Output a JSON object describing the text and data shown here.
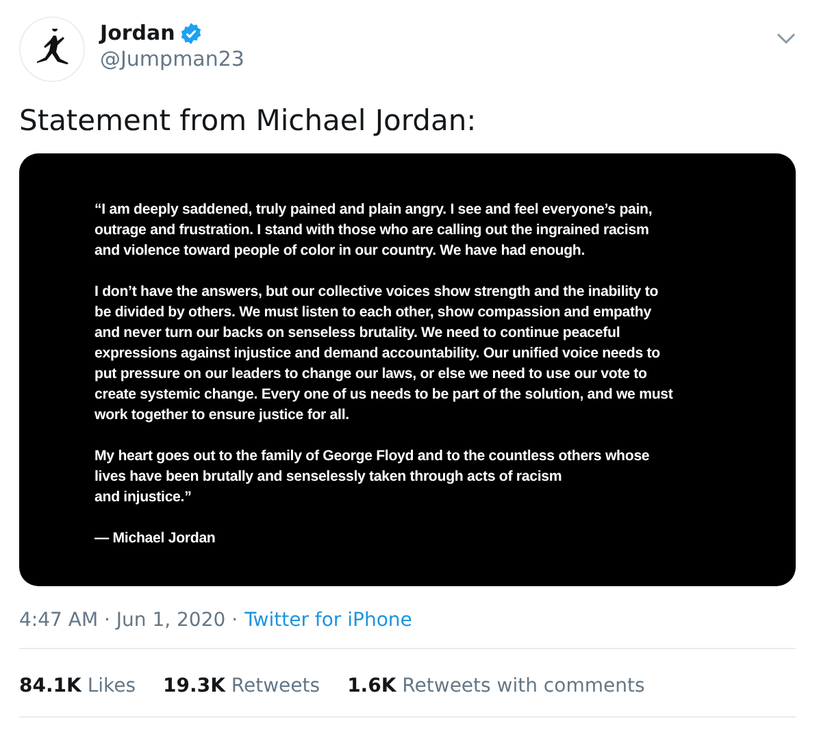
{
  "author": {
    "name": "Jordan",
    "verified": true,
    "handle": "@Jumpman23"
  },
  "text": "Statement from Michael Jordan:",
  "statement": {
    "paragraphs": [
      [
        "“I am deeply saddened, truly pained and plain angry. I see and feel everyone’s pain,",
        "outrage and frustration. I stand with those who are calling out the ingrained racism",
        "and violence toward people of color in our country. We have had enough."
      ],
      [
        "I don’t have the answers, but our collective voices show strength and the inability to",
        "be divided by others. We must listen to each other, show compassion and empathy",
        "and never turn our backs on senseless brutality. We need to continue peaceful",
        "expressions against injustice and demand accountability. Our unified voice needs to",
        "put pressure on our leaders to change our laws, or else we need to use our vote to",
        "create systemic change. Every one of us needs to be part of the solution, and we must",
        "work together to ensure justice for all."
      ],
      [
        "My heart goes out to the family of George Floyd and to the countless others whose",
        "lives have been brutally and senselessly taken through acts of racism",
        "and injustice.”"
      ]
    ],
    "signature": "— Michael Jordan"
  },
  "meta": {
    "time": "4:47 AM · Jun 1, 2020 ·",
    "source": "Twitter for iPhone"
  },
  "stats": [
    {
      "count": "84.1K",
      "label": "Likes"
    },
    {
      "count": "19.3K",
      "label": "Retweets"
    },
    {
      "count": "1.6K",
      "label": "Retweets with comments"
    }
  ]
}
